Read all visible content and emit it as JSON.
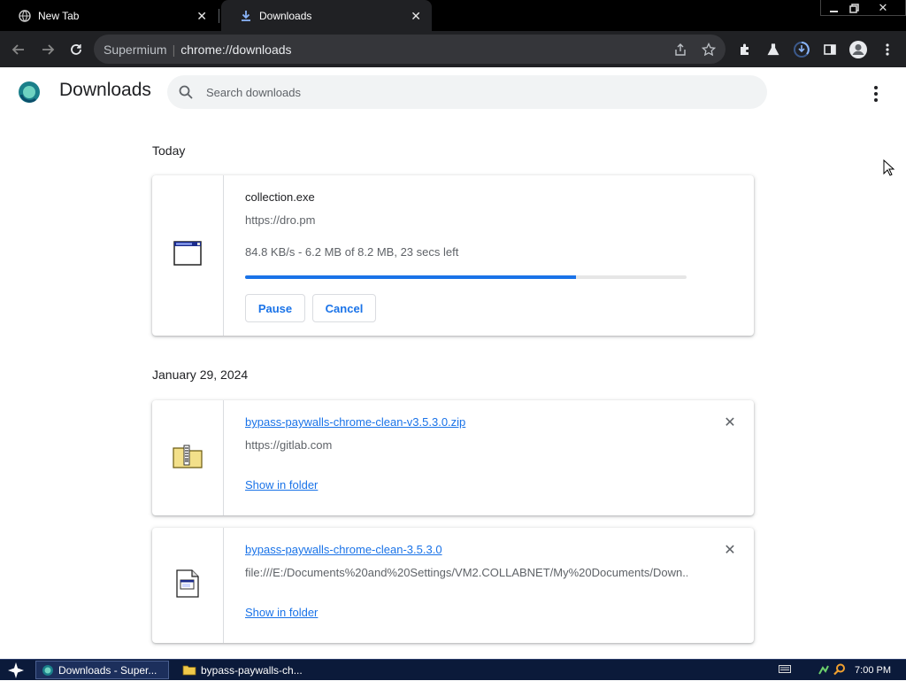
{
  "tabs": [
    {
      "label": "New Tab",
      "active": false
    },
    {
      "label": "Downloads",
      "active": true
    }
  ],
  "toolbar": {
    "omnibox_brand": "Supermium",
    "omnibox_url": "chrome://downloads"
  },
  "header": {
    "title": "Downloads",
    "search_placeholder": "Search downloads"
  },
  "sections": {
    "today": "Today",
    "older": "January 29, 2024"
  },
  "downloads": [
    {
      "filename": "collection.exe",
      "source": "https://dro.pm",
      "status": "84.8 KB/s - 6.2 MB of 8.2 MB, 23 secs left",
      "progress": 0.75,
      "pause_label": "Pause",
      "cancel_label": "Cancel"
    },
    {
      "filename": "bypass-paywalls-chrome-clean-v3.5.3.0.zip",
      "source": "https://gitlab.com",
      "action_label": "Show in folder"
    },
    {
      "filename": "bypass-paywalls-chrome-clean-3.5.3.0",
      "source": "file:///E:/Documents%20and%20Settings/VM2.COLLABNET/My%20Documents/Down...",
      "action_label": "Show in folder"
    }
  ],
  "taskbar": {
    "items": [
      {
        "label": "Downloads - Super..."
      },
      {
        "label": "bypass-paywalls-ch..."
      }
    ],
    "clock": "7:00 PM"
  },
  "colors": {
    "accent": "#1a73e8",
    "toolbar_bg": "#202124",
    "taskbar_bg": "#0b1a3a"
  }
}
